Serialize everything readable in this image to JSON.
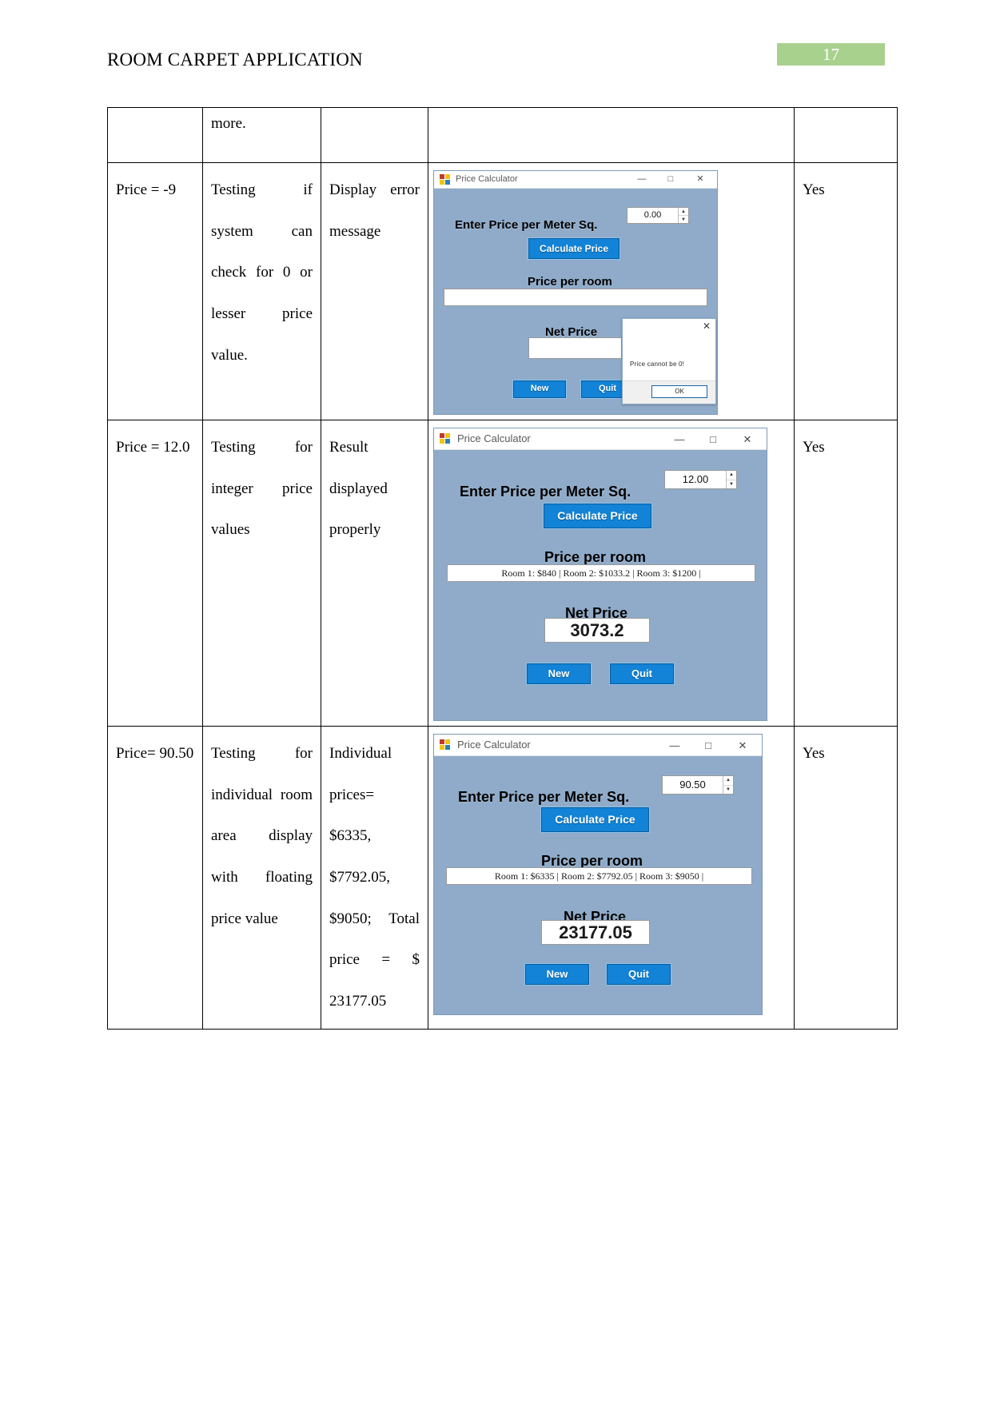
{
  "header": {
    "doc_title": "ROOM CARPET APPLICATION",
    "page_number": "17"
  },
  "table": {
    "rows": [
      {
        "id": "row-continued",
        "col1": "",
        "col2": "more.",
        "col3": "",
        "col5": ""
      },
      {
        "id": "row-price-neg9",
        "col1": "Price = -9",
        "col2": "Testing if system can check for 0 or lesser price value.",
        "col3": "Display error message",
        "col5": "Yes",
        "app": {
          "name": "price-calculator-error",
          "window_title": "Price Calculator",
          "minimize": "—",
          "maximize": "□",
          "close": "✕",
          "enter_price_label": "Enter Price per Meter Sq.",
          "price_value": "0.00",
          "spin_up": "▲",
          "spin_down": "▼",
          "calculate_button": "Calculate Price",
          "price_per_room_label": "Price per room",
          "price_per_room_value": "",
          "net_price_label": "Net Price",
          "net_price_value": "",
          "new_button": "New",
          "quit_button": "Quit",
          "dialog": {
            "close": "✕",
            "message": "Price cannot be 0!",
            "ok_button": "OK"
          }
        }
      },
      {
        "id": "row-price-12",
        "col1": "Price = 12.0",
        "col2": "Testing for integer price values",
        "col3": "Result displayed properly",
        "col5": "Yes",
        "app": {
          "name": "price-calculator-12",
          "window_title": "Price Calculator",
          "minimize": "—",
          "maximize": "□",
          "close": "✕",
          "enter_price_label": "Enter Price per Meter Sq.",
          "price_value": "12.00",
          "spin_up": "▲",
          "spin_down": "▼",
          "calculate_button": "Calculate Price",
          "price_per_room_label": "Price per room",
          "price_per_room_value": "Room 1: $840 | Room 2: $1033.2 | Room 3: $1200 |",
          "net_price_label": "Net Price",
          "net_price_value": "3073.2",
          "new_button": "New",
          "quit_button": "Quit"
        }
      },
      {
        "id": "row-price-9050",
        "col1": "Price= 90.50",
        "col2": "Testing for individual room area display with floating price value",
        "col3": "Individual prices= $6335, $7792.05, $9050; Total price = $ 23177.05",
        "col5": "Yes",
        "app": {
          "name": "price-calculator-9050",
          "window_title": "Price Calculator",
          "minimize": "—",
          "maximize": "□",
          "close": "✕",
          "enter_price_label": "Enter Price per Meter Sq.",
          "price_value": "90.50",
          "spin_up": "▲",
          "spin_down": "▼",
          "calculate_button": "Calculate Price",
          "price_per_room_label": "Price per room",
          "price_per_room_value": "Room 1: $6335 | Room 2: $7792.05 | Room 3: $9050 |",
          "net_price_label": "Net Price",
          "net_price_value": "23177.05",
          "new_button": "New",
          "quit_button": "Quit"
        }
      }
    ]
  },
  "colors": {
    "form_background": "#8fabc9",
    "button_blue": "#1283d6",
    "badge_green": "#a9d18e"
  }
}
